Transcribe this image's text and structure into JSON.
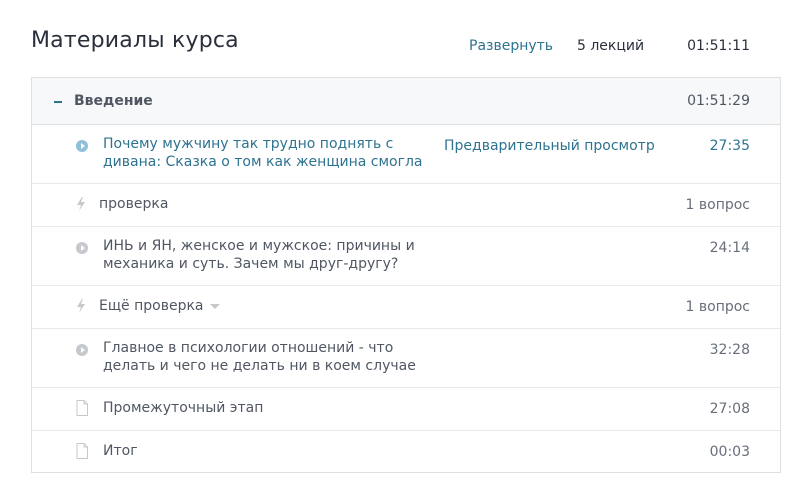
{
  "header": {
    "title": "Материалы курса",
    "expand_label": "Развернуть",
    "lecture_count": "5 лекций",
    "total_duration": "01:51:11"
  },
  "section": {
    "title": "Введение",
    "duration": "01:51:29",
    "items": [
      {
        "type": "video",
        "title": "Почему мужчину так трудно поднять с дивана: Сказка о том как женщина смогла",
        "preview_label": "Предварительный просмотр",
        "meta": "27:35",
        "icon": "play-icon"
      },
      {
        "type": "quiz",
        "title": "проверка",
        "meta": "1 вопрос",
        "icon": "bolt-icon"
      },
      {
        "type": "video",
        "title": "ИНЬ и ЯН, женское и мужское: причины и механика и суть. Зачем мы друг-другу?",
        "meta": "24:14",
        "icon": "play-icon"
      },
      {
        "type": "quiz",
        "title": "Ещё проверка",
        "meta": "1 вопрос",
        "icon": "bolt-icon"
      },
      {
        "type": "video",
        "title": "Главное в психологии отношений - что делать и чего не делать ни в коем случае",
        "meta": "32:28",
        "icon": "play-icon"
      },
      {
        "type": "document",
        "title": "Промежуточный этап",
        "meta": "27:08",
        "icon": "doc-icon"
      },
      {
        "type": "document",
        "title": "Итог",
        "meta": "00:03",
        "icon": "doc-icon"
      }
    ]
  },
  "colors": {
    "link": "#2e7390",
    "text": "#29303b",
    "muted": "#686f7a",
    "border": "#dedfe0",
    "section_bg": "#f7f8fa"
  }
}
